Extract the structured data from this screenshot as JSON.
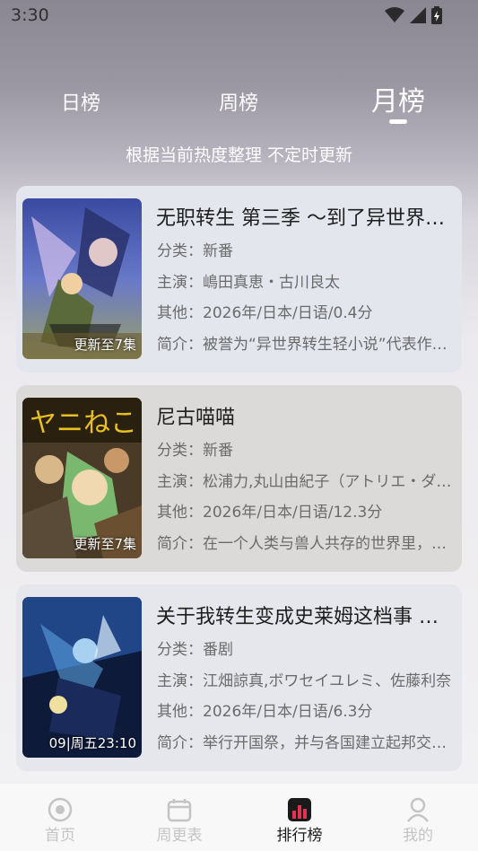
{
  "status_bar": {
    "time": "3:30",
    "icons": [
      "wifi-icon",
      "signal-icon",
      "battery-icon"
    ]
  },
  "tabs": [
    {
      "label": "日榜",
      "active": false
    },
    {
      "label": "周榜",
      "active": false
    },
    {
      "label": "月榜",
      "active": true
    }
  ],
  "subtitle": "根据当前热度整理 不定时更新",
  "cards": [
    {
      "title": "无职转生 第三季 ～到了异世界就拿出真本事～",
      "category": "分类：新番",
      "cast": "主演：嶋田真恵・古川良太",
      "other": "其他：2026年/日本/日语/0.4分",
      "intro": "简介：被誉为“异世界转生轻小说”代表作品的无职转生",
      "badge": "更新至7集"
    },
    {
      "title": "尼古喵喵",
      "category": "分类：新番",
      "cast": "主演：松浦力,丸山由紀子（アトリエ・ダンデライオン）",
      "other": "其他：2026年/日本/日语/12.3分",
      "intro": "简介：在一个人类与兽人共存的世界里，少年与猫耳少女",
      "badge": "更新至7集"
    },
    {
      "title": "关于我转生变成史莱姆这档事 第四季",
      "category": "分类：番剧",
      "cast": "主演：江畑諒真,ボワセイユレミ、佐藤利奈",
      "other": "其他：2026年/日本/日语/6.3分",
      "intro": "简介：举行开国祭，并与各国建立起邦交关系的魔国联邦",
      "badge": "09|周五23:10"
    }
  ],
  "bottom_nav": [
    {
      "label": "首页",
      "icon": "home-icon",
      "active": false
    },
    {
      "label": "周更表",
      "icon": "calendar-icon",
      "active": false
    },
    {
      "label": "排行榜",
      "icon": "ranking-icon",
      "active": true
    },
    {
      "label": "我的",
      "icon": "profile-icon",
      "active": false
    }
  ],
  "colors": {
    "active_nav": "#e8314f",
    "inactive_nav": "#c4c4c4"
  }
}
